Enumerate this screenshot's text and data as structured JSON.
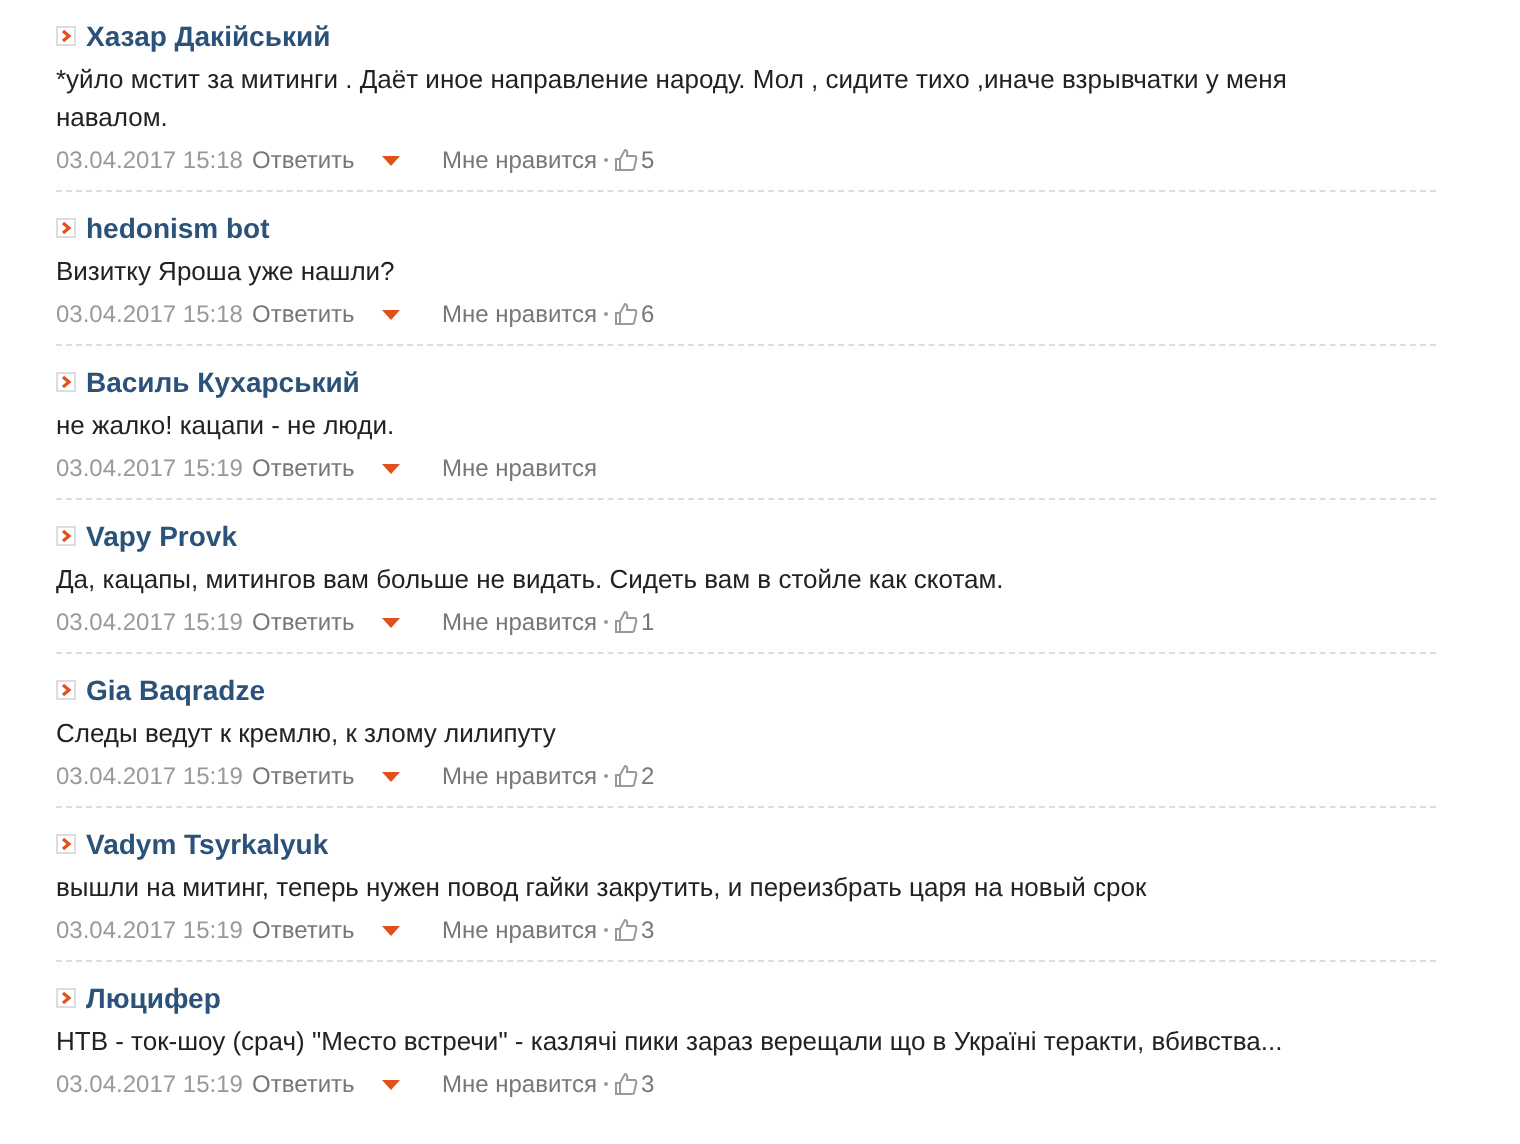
{
  "comments": [
    {
      "author": "Хазар Дакійський",
      "text": "*уйло мстит за митинги . Даёт иное направление народу. Мол , сидите тихо ,иначе взрывчатки у меня навалом.",
      "time": "03.04.2017 15:18",
      "reply": "Ответить",
      "like": "Мне нравится",
      "likes": "5"
    },
    {
      "author": "hedonism bot",
      "text": "Визитку Яроша уже нашли?",
      "time": "03.04.2017 15:18",
      "reply": "Ответить",
      "like": "Мне нравится",
      "likes": "6"
    },
    {
      "author": "Василь Кухарський",
      "text": "не жалко! кацапи - не люди.",
      "time": "03.04.2017 15:19",
      "reply": "Ответить",
      "like": "Мне нравится"
    },
    {
      "author": "Vapy Provk",
      "text": "Да, кацапы, митингов вам больше не видать. Сидеть вам в стойле как скотам.",
      "time": "03.04.2017 15:19",
      "reply": "Ответить",
      "like": "Мне нравится",
      "likes": "1"
    },
    {
      "author": "Gia Baqradze",
      "text": "Следы ведут к кремлю, к злому лилипуту",
      "time": "03.04.2017 15:19",
      "reply": "Ответить",
      "like": "Мне нравится",
      "likes": "2"
    },
    {
      "author": "Vadym Tsyrkalyuk",
      "text": "вышли на митинг, теперь нужен повод гайки закрутить, и переизбрать царя на новый срок",
      "time": "03.04.2017 15:19",
      "reply": "Ответить",
      "like": "Мне нравится",
      "likes": "3"
    },
    {
      "author": "Люцифер",
      "text": "НТВ - ток-шоу (срач) \"Место встречи\" - казлячі пики зараз верещали що в Україні теракти, вбивства...",
      "time": "03.04.2017 15:19",
      "reply": "Ответить",
      "like": "Мне нравится",
      "likes": "3"
    }
  ]
}
